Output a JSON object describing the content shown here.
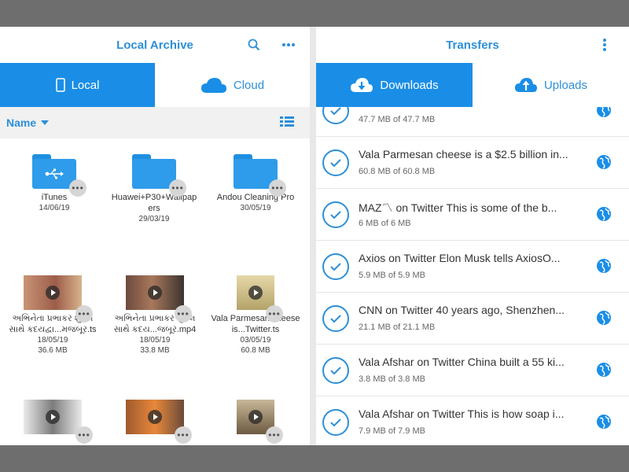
{
  "left": {
    "title": "Local Archive",
    "tabs": [
      {
        "label": "Local",
        "icon": "phone-icon",
        "active": true
      },
      {
        "label": "Cloud",
        "icon": "cloud-icon",
        "active": false
      }
    ],
    "sort_label": "Name",
    "items": [
      {
        "type": "folder",
        "badge": "usb-icon",
        "name": "iTunes",
        "date": "14/06/19"
      },
      {
        "type": "folder",
        "name": "Huawei+P30+Wallpapers",
        "date": "29/03/19"
      },
      {
        "type": "folder",
        "name": "Andou Cleaning Pro",
        "date": "30/05/19"
      },
      {
        "type": "video",
        "name": "અભિનેતા પ્રભાકર શુક્લ સાથે કદયદ્વા...મજબૂર.ts",
        "date": "18/05/19",
        "size": "36.6 MB"
      },
      {
        "type": "video",
        "name": "અભિનેતા પ્રભાકર શુક્લ સાથે કદય...જબૂર.mp4",
        "date": "18/05/19",
        "size": "33.8 MB"
      },
      {
        "type": "video",
        "name": "Vala Parmesan cheese is...Twitter.ts",
        "date": "03/05/19",
        "size": "60.8 MB"
      },
      {
        "type": "video",
        "name": "",
        "date": "",
        "size": ""
      },
      {
        "type": "video",
        "name": "",
        "date": "",
        "size": ""
      },
      {
        "type": "video",
        "name": "",
        "date": "",
        "size": ""
      }
    ]
  },
  "right": {
    "title": "Transfers",
    "tabs": [
      {
        "label": "Downloads",
        "icon": "cloud-download-icon",
        "active": true
      },
      {
        "label": "Uploads",
        "icon": "cloud-upload-icon",
        "active": false
      }
    ],
    "transfers": [
      {
        "title": "",
        "size": "47.7 MB of 47.7 MB"
      },
      {
        "title": "Vala Parmesan cheese is a $2.5 billion in...",
        "size": "60.8 MB of 60.8 MB"
      },
      {
        "title": "MAZ〽 on Twitter This is some of the b...",
        "size": "6 MB of 6 MB"
      },
      {
        "title": "Axios on Twitter Elon Musk tells AxiosO...",
        "size": "5.9 MB of 5.9 MB"
      },
      {
        "title": "CNN on Twitter 40 years ago, Shenzhen...",
        "size": "21.1 MB of 21.1 MB"
      },
      {
        "title": "Vala Afshar on Twitter China built a 55 ki...",
        "size": "3.8 MB of 3.8 MB"
      },
      {
        "title": "Vala Afshar on Twitter This is how soap i...",
        "size": "7.9 MB of 7.9 MB"
      }
    ]
  },
  "colors": {
    "accent": "#1a8ee6",
    "text_blue": "#2d8fd8"
  }
}
